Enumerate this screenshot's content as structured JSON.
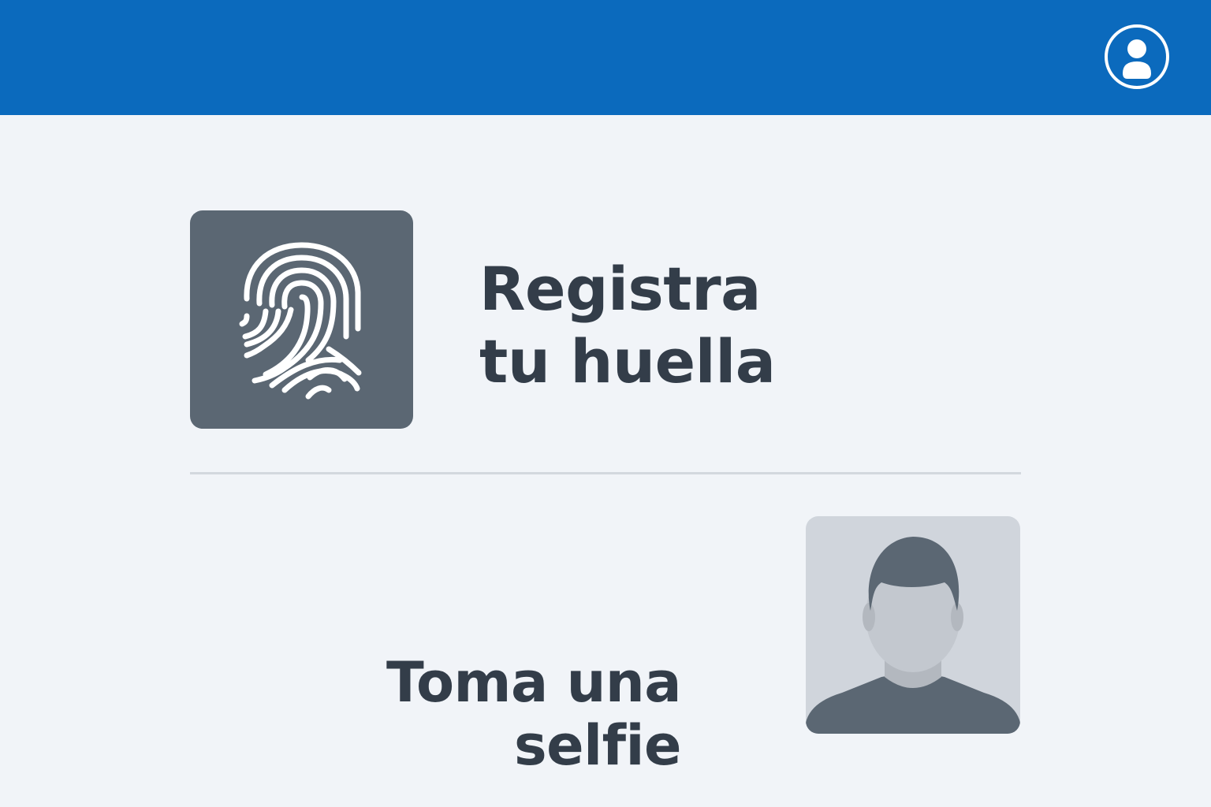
{
  "header": {
    "color": "#0b6abd",
    "profile_icon": "user-circle-icon"
  },
  "options": [
    {
      "id": "fingerprint",
      "icon": "fingerprint-icon",
      "label_lines": [
        "Registra",
        "tu huella"
      ]
    },
    {
      "id": "selfie",
      "icon": "person-silhouette-icon",
      "label_lines": [
        "Toma una",
        "selfie"
      ]
    }
  ],
  "colors": {
    "background": "#f1f4f8",
    "text": "#333d49",
    "tile_dark": "#5b6773",
    "tile_light": "#d0d5dc"
  }
}
